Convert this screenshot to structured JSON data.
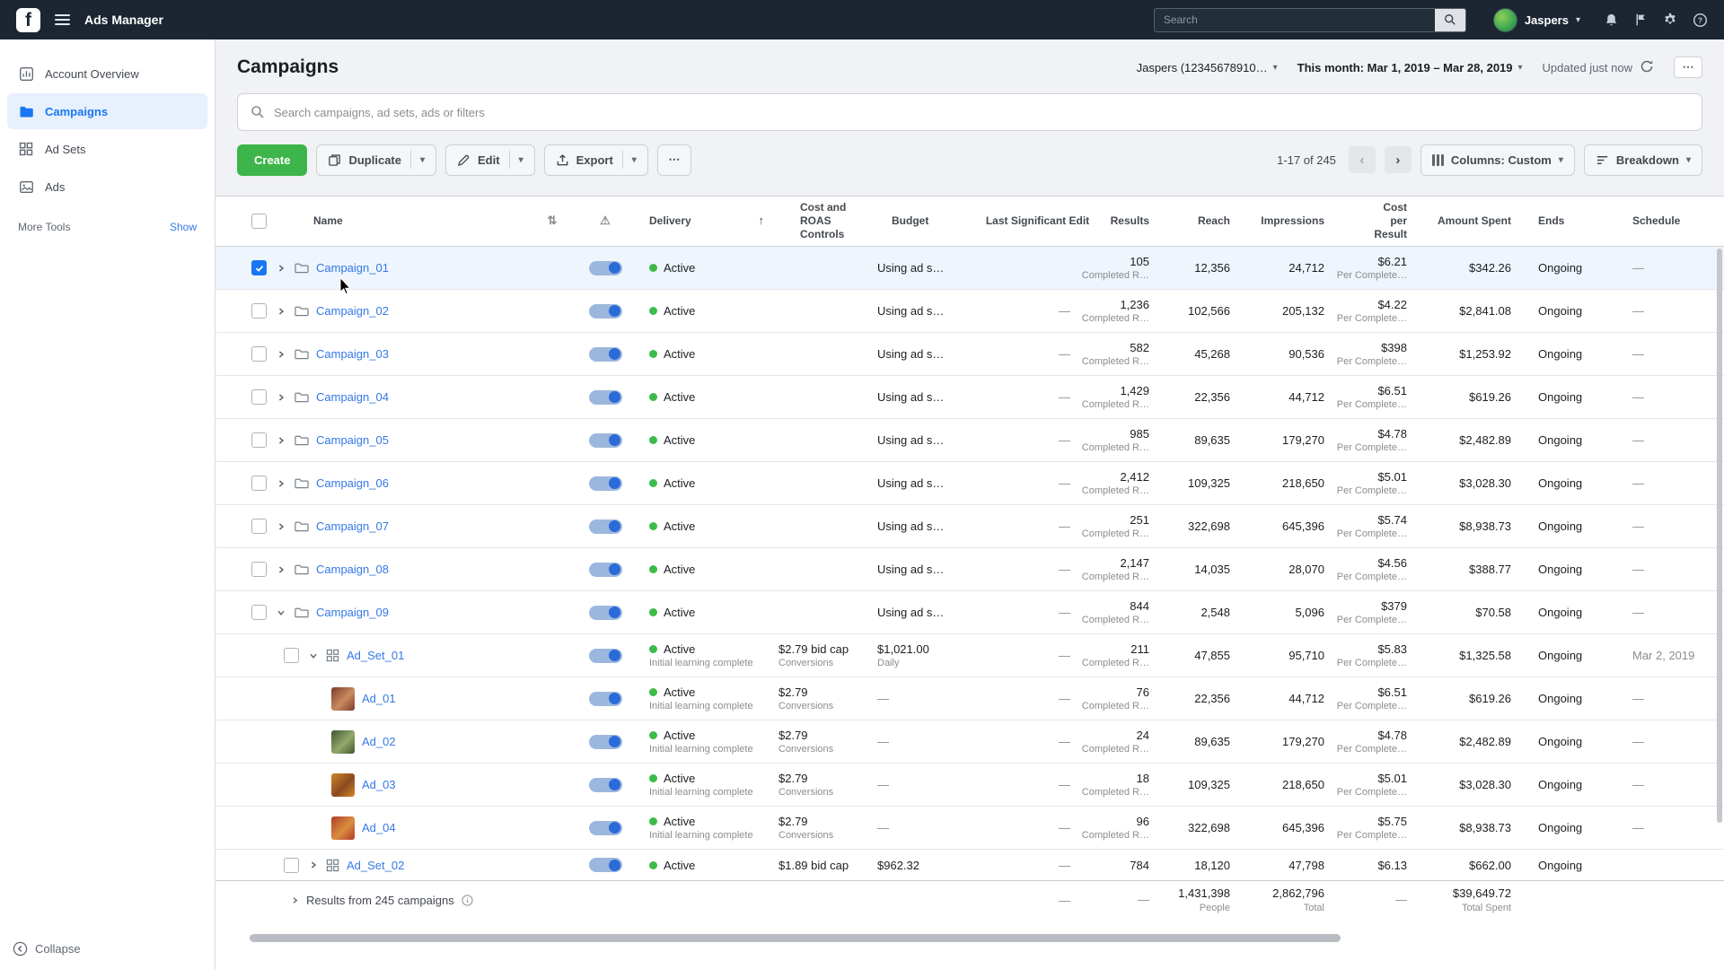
{
  "colors": {
    "accent_blue": "#1877f2",
    "link_blue": "#3578e5",
    "green": "#3dbb4a",
    "topbar_bg": "#1b2632"
  },
  "icons": {
    "sort": "⇅",
    "warning": "⚠",
    "sort_arrow": "↑",
    "ellipsis": "⋯",
    "caret_down": "▾",
    "chevron_left": "‹",
    "chevron_right": "›"
  },
  "topbar": {
    "app_title": "Ads Manager",
    "search_placeholder": "Search",
    "user_name": "Jaspers"
  },
  "sidebar": {
    "items": [
      {
        "label": "Account Overview"
      },
      {
        "label": "Campaigns"
      },
      {
        "label": "Ad Sets"
      },
      {
        "label": "Ads"
      }
    ],
    "more_tools": "More Tools",
    "show_link": "Show",
    "collapse": "Collapse"
  },
  "header": {
    "title": "Campaigns",
    "account": "Jaspers (12345678910…",
    "date_range": "This month: Mar 1, 2019 – Mar 28, 2019",
    "updated": "Updated just now"
  },
  "search": {
    "placeholder": "Search campaigns, ad sets, ads or filters"
  },
  "toolbar": {
    "create": "Create",
    "duplicate": "Duplicate",
    "edit": "Edit",
    "export": "Export",
    "range": "1-17 of 245",
    "columns_label": "Columns: Custom",
    "breakdown_label": "Breakdown"
  },
  "table": {
    "headers": {
      "name": "Name",
      "delivery": "Delivery",
      "cost": "Cost and ROAS Controls",
      "budget": "Budget",
      "last_edit": "Last Significant Edit",
      "results": "Results",
      "reach": "Reach",
      "impressions": "Impressions",
      "cost_per": "Cost per Result",
      "spent": "Amount Spent",
      "ends": "Ends",
      "schedule": "Schedule"
    },
    "rows": [
      {
        "type": "campaign",
        "name": "Campaign_01",
        "checked": true,
        "selected": true,
        "caret": "collapsed",
        "status": "Active",
        "budget": "Using ad s…",
        "last_edit": "",
        "results": "105",
        "results_sub": "Completed R…",
        "reach": "12,356",
        "impressions": "24,712",
        "cost_per": "$6.21",
        "cost_per_sub": "Per Complete…",
        "spent": "$342.26",
        "ends": "Ongoing",
        "schedule": "—"
      },
      {
        "type": "campaign",
        "name": "Campaign_02",
        "caret": "collapsed",
        "status": "Active",
        "budget": "Using ad s…",
        "last_edit": "—",
        "results": "1,236",
        "results_sub": "Completed R…",
        "reach": "102,566",
        "impressions": "205,132",
        "cost_per": "$4.22",
        "cost_per_sub": "Per Complete…",
        "spent": "$2,841.08",
        "ends": "Ongoing",
        "schedule": "—"
      },
      {
        "type": "campaign",
        "name": "Campaign_03",
        "caret": "collapsed",
        "status": "Active",
        "budget": "Using ad s…",
        "last_edit": "—",
        "results": "582",
        "results_sub": "Completed R…",
        "reach": "45,268",
        "impressions": "90,536",
        "cost_per": "$398",
        "cost_per_sub": "Per Complete…",
        "spent": "$1,253.92",
        "ends": "Ongoing",
        "schedule": "—"
      },
      {
        "type": "campaign",
        "name": "Campaign_04",
        "caret": "collapsed",
        "status": "Active",
        "budget": "Using ad s…",
        "last_edit": "—",
        "results": "1,429",
        "results_sub": "Completed R…",
        "reach": "22,356",
        "impressions": "44,712",
        "cost_per": "$6.51",
        "cost_per_sub": "Per Complete…",
        "spent": "$619.26",
        "ends": "Ongoing",
        "schedule": "—"
      },
      {
        "type": "campaign",
        "name": "Campaign_05",
        "caret": "collapsed",
        "status": "Active",
        "budget": "Using ad s…",
        "last_edit": "—",
        "results": "985",
        "results_sub": "Completed R…",
        "reach": "89,635",
        "impressions": "179,270",
        "cost_per": "$4.78",
        "cost_per_sub": "Per Complete…",
        "spent": "$2,482.89",
        "ends": "Ongoing",
        "schedule": "—"
      },
      {
        "type": "campaign",
        "name": "Campaign_06",
        "caret": "collapsed",
        "status": "Active",
        "budget": "Using ad s…",
        "last_edit": "—",
        "results": "2,412",
        "results_sub": "Completed R…",
        "reach": "109,325",
        "impressions": "218,650",
        "cost_per": "$5.01",
        "cost_per_sub": "Per Complete…",
        "spent": "$3,028.30",
        "ends": "Ongoing",
        "schedule": "—"
      },
      {
        "type": "campaign",
        "name": "Campaign_07",
        "caret": "collapsed",
        "status": "Active",
        "budget": "Using ad s…",
        "last_edit": "—",
        "results": "251",
        "results_sub": "Completed R…",
        "reach": "322,698",
        "impressions": "645,396",
        "cost_per": "$5.74",
        "cost_per_sub": "Per Complete…",
        "spent": "$8,938.73",
        "ends": "Ongoing",
        "schedule": "—"
      },
      {
        "type": "campaign",
        "name": "Campaign_08",
        "caret": "collapsed",
        "status": "Active",
        "budget": "Using ad s…",
        "last_edit": "—",
        "results": "2,147",
        "results_sub": "Completed R…",
        "reach": "14,035",
        "impressions": "28,070",
        "cost_per": "$4.56",
        "cost_per_sub": "Per Complete…",
        "spent": "$388.77",
        "ends": "Ongoing",
        "schedule": "—"
      },
      {
        "type": "campaign",
        "name": "Campaign_09",
        "caret": "expanded",
        "status": "Active",
        "budget": "Using ad s…",
        "last_edit": "—",
        "results": "844",
        "results_sub": "Completed R…",
        "reach": "2,548",
        "impressions": "5,096",
        "cost_per": "$379",
        "cost_per_sub": "Per Complete…",
        "spent": "$70.58",
        "ends": "Ongoing",
        "schedule": "—"
      },
      {
        "type": "adset",
        "name": "Ad_Set_01",
        "caret": "expanded",
        "status": "Active",
        "status_sub": "Initial learning complete",
        "cost": "$2.79 bid cap",
        "cost_sub": "Conversions",
        "budget": "$1,021.00",
        "budget_sub": "Daily",
        "last_edit": "—",
        "results": "211",
        "results_sub": "Completed R…",
        "reach": "47,855",
        "impressions": "95,710",
        "cost_per": "$5.83",
        "cost_per_sub": "Per Complete…",
        "spent": "$1,325.58",
        "ends": "Ongoing",
        "schedule": "Mar 2, 2019"
      },
      {
        "type": "ad",
        "name": "Ad_01",
        "thumb": [
          "#7a3b2e",
          "#c98a5e"
        ],
        "status": "Active",
        "status_sub": "Initial learning complete",
        "cost": "$2.79",
        "cost_sub": "Conversions",
        "budget": "—",
        "last_edit": "—",
        "results": "76",
        "results_sub": "Completed R…",
        "reach": "22,356",
        "impressions": "44,712",
        "cost_per": "$6.51",
        "cost_per_sub": "Per Complete…",
        "spent": "$619.26",
        "ends": "Ongoing",
        "schedule": "—"
      },
      {
        "type": "ad",
        "name": "Ad_02",
        "thumb": [
          "#3f5632",
          "#93a86b"
        ],
        "status": "Active",
        "status_sub": "Initial learning complete",
        "cost": "$2.79",
        "cost_sub": "Conversions",
        "budget": "—",
        "last_edit": "—",
        "results": "24",
        "results_sub": "Completed R…",
        "reach": "89,635",
        "impressions": "179,270",
        "cost_per": "$4.78",
        "cost_per_sub": "Per Complete…",
        "spent": "$2,482.89",
        "ends": "Ongoing",
        "schedule": "—"
      },
      {
        "type": "ad",
        "name": "Ad_03",
        "thumb": [
          "#d1862a",
          "#8a4a1f"
        ],
        "status": "Active",
        "status_sub": "Initial learning complete",
        "cost": "$2.79",
        "cost_sub": "Conversions",
        "budget": "—",
        "last_edit": "—",
        "results": "18",
        "results_sub": "Completed R…",
        "reach": "109,325",
        "impressions": "218,650",
        "cost_per": "$5.01",
        "cost_per_sub": "Per Complete…",
        "spent": "$3,028.30",
        "ends": "Ongoing",
        "schedule": "—"
      },
      {
        "type": "ad",
        "name": "Ad_04",
        "thumb": [
          "#b03a2a",
          "#d98f3e"
        ],
        "status": "Active",
        "status_sub": "Initial learning complete",
        "cost": "$2.79",
        "cost_sub": "Conversions",
        "budget": "—",
        "last_edit": "—",
        "results": "96",
        "results_sub": "Completed R…",
        "reach": "322,698",
        "impressions": "645,396",
        "cost_per": "$5.75",
        "cost_per_sub": "Per Complete…",
        "spent": "$8,938.73",
        "ends": "Ongoing",
        "schedule": "—"
      },
      {
        "type": "adset",
        "name": "Ad_Set_02",
        "caret": "collapsed",
        "cut": true,
        "status": "Active",
        "cost": "$1.89 bid cap",
        "budget": "$962.32",
        "last_edit": "—",
        "results": "784",
        "reach": "18,120",
        "impressions": "47,798",
        "cost_per": "$6.13",
        "spent": "$662.00",
        "ends": "Ongoing",
        "schedule": ""
      }
    ],
    "footer": {
      "label": "Results from 245 campaigns",
      "last_edit": "—",
      "results": "—",
      "reach": "1,431,398",
      "reach_sub": "People",
      "impressions": "2,862,796",
      "impressions_sub": "Total",
      "cost_per": "—",
      "spent": "$39,649.72",
      "spent_sub": "Total Spent"
    }
  }
}
